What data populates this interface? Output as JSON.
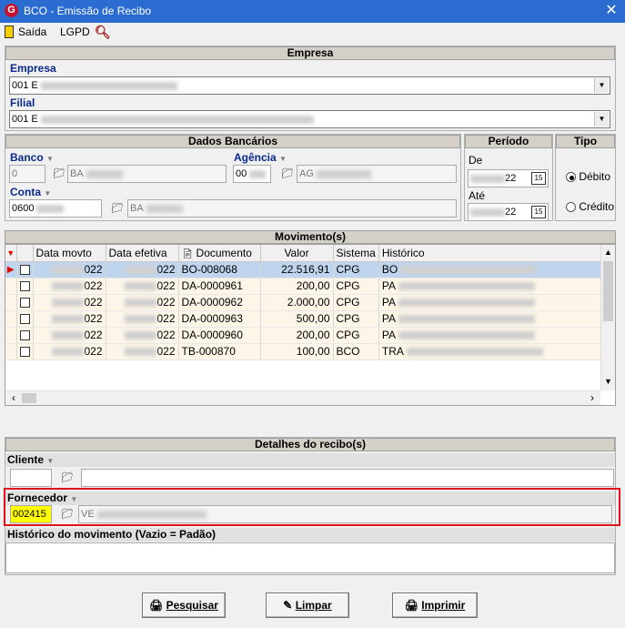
{
  "window": {
    "title": "BCO - Emissão de Recibo",
    "close": "✕"
  },
  "menu": {
    "exit": "Saída",
    "lgpd": "LGPD"
  },
  "empresa": {
    "header": "Empresa",
    "empresa_label": "Empresa",
    "empresa_value": "001 E",
    "filial_label": "Filial",
    "filial_value": "001 E"
  },
  "banco": {
    "header": "Dados Bancários",
    "banco_label": "Banco",
    "banco_code": "0",
    "banco_name": "BA",
    "agencia_label": "Agência",
    "agencia_code": "00",
    "agencia_name": "AG",
    "conta_label": "Conta",
    "conta_code": "0600",
    "conta_name": "BA"
  },
  "periodo": {
    "header": "Período",
    "de_label": "De",
    "de_value": "22",
    "ate_label": "Até",
    "ate_value": "22",
    "calendar_glyph": "15"
  },
  "tipo": {
    "header": "Tipo",
    "debito": "Débito",
    "credito": "Crédito",
    "selected": "Débito"
  },
  "movimentos": {
    "header": "Movimento(s)",
    "columns": [
      "Data movto",
      "Data efetiva",
      "Documento",
      "Valor",
      "Sistema",
      "Histórico"
    ],
    "rows": [
      {
        "data_movto": "022",
        "data_efetiva": "022",
        "documento": "BO-008068",
        "valor": "22.516,91",
        "sistema": "CPG",
        "historico": "BO"
      },
      {
        "data_movto": "022",
        "data_efetiva": "022",
        "documento": "DA-0000961",
        "valor": "200,00",
        "sistema": "CPG",
        "historico": "PA"
      },
      {
        "data_movto": "022",
        "data_efetiva": "022",
        "documento": "DA-0000962",
        "valor": "2.000,00",
        "sistema": "CPG",
        "historico": "PA"
      },
      {
        "data_movto": "022",
        "data_efetiva": "022",
        "documento": "DA-0000963",
        "valor": "500,00",
        "sistema": "CPG",
        "historico": "PA"
      },
      {
        "data_movto": "022",
        "data_efetiva": "022",
        "documento": "DA-0000960",
        "valor": "200,00",
        "sistema": "CPG",
        "historico": "PA"
      },
      {
        "data_movto": "022",
        "data_efetiva": "022",
        "documento": "TB-000870",
        "valor": "100,00",
        "sistema": "BCO",
        "historico": "TRA"
      }
    ]
  },
  "detalhes": {
    "header": "Detalhes do recibo(s)",
    "cliente_label": "Cliente",
    "cliente_code": "",
    "cliente_name": "",
    "fornecedor_label": "Fornecedor",
    "fornecedor_code": "002415",
    "fornecedor_name": "VE",
    "historico_label": "Histórico do movimento (Vazio = Padão)",
    "historico_value": ""
  },
  "buttons": {
    "pesquisar": "Pesquisar",
    "limpar": "Limpar",
    "imprimir": "Imprimir"
  },
  "colors": {
    "titlebar": "#2b6cd1",
    "label_blue": "#0b2a8c",
    "highlight_yellow": "#ffff00",
    "red_frame": "#e0121b",
    "selected_row": "#bfd5ee"
  }
}
